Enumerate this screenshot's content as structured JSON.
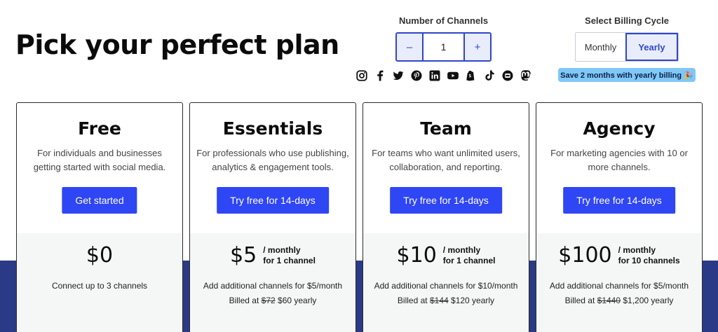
{
  "header": {
    "title": "Pick your perfect plan"
  },
  "channels": {
    "label": "Number of Channels",
    "decrement": "–",
    "increment": "+",
    "value": "1"
  },
  "billing": {
    "label": "Select Billing Cycle",
    "options": [
      "Monthly",
      "Yearly"
    ],
    "selected": "Yearly",
    "badge": "Save 2 months with yearly billing 🎉"
  },
  "social_icons": [
    "instagram-icon",
    "facebook-icon",
    "twitter-icon",
    "pinterest-icon",
    "linkedin-icon",
    "youtube-icon",
    "shopify-icon",
    "tiktok-icon",
    "google-business-icon",
    "mastodon-icon"
  ],
  "plans": [
    {
      "name": "Free",
      "description": "For individuals and businesses getting started with social media.",
      "cta": "Get started",
      "price": "$0",
      "per": "",
      "per_detail": "",
      "note": "Connect up to 3 channels",
      "billed_label": "",
      "billed_old": "",
      "billed_new": ""
    },
    {
      "name": "Essentials",
      "description": "For professionals who use publishing, analytics & engagement tools.",
      "cta": "Try free for 14-days",
      "price": "$5",
      "per": "/ monthly",
      "per_detail": "for 1 channel",
      "note": "Add additional channels for $5/month",
      "billed_label": "Billed at",
      "billed_old": "$72",
      "billed_new": "$60 yearly"
    },
    {
      "name": "Team",
      "description": "For teams who want unlimited users, collaboration, and reporting.",
      "cta": "Try free for 14-days",
      "price": "$10",
      "per": "/ monthly",
      "per_detail": "for 1 channel",
      "note": "Add additional channels for $10/month",
      "billed_label": "Billed at",
      "billed_old": "$144",
      "billed_new": "$120 yearly"
    },
    {
      "name": "Agency",
      "description": "For marketing agencies with 10 or more channels.",
      "cta": "Try free for 14-days",
      "price": "$100",
      "per": "/ monthly",
      "per_detail": "for 10 channels",
      "note": "Add additional channels for $5/month",
      "billed_label": "Billed at",
      "billed_old": "$1440",
      "billed_new": "$1,200 yearly"
    }
  ],
  "colors": {
    "accent": "#2f46f5",
    "band": "#2b3a86",
    "badge": "#7fc8f8"
  }
}
